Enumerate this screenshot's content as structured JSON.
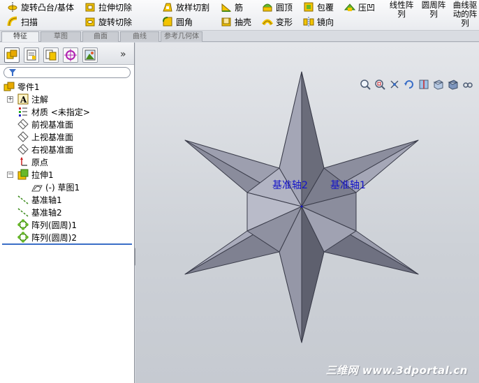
{
  "toolbar": {
    "revolve_boss": "旋转凸台/基体",
    "extruded_cut": "拉伸切除",
    "lofted_cut": "放样切割",
    "rib": "筋",
    "dome": "圆顶",
    "wrap": "包覆",
    "indent": "压凹",
    "sweep": "扫描",
    "revolved_cut": "旋转切除",
    "fillet": "圆角",
    "shell": "抽壳",
    "flex": "变形",
    "mirror": "镜向",
    "linear_pattern": "线性阵\n列",
    "circular_pattern": "圆周阵\n列",
    "curve_pattern": "曲线驱\n动的阵\n列"
  },
  "tabs": [
    "特征",
    "草图",
    "曲面",
    "曲线",
    "参考几何体"
  ],
  "tree": {
    "root": "零件1",
    "items": [
      {
        "label": "注解",
        "icon": "annotations-icon"
      },
      {
        "label": "材质 <未指定>",
        "icon": "material-icon"
      },
      {
        "label": "前视基准面",
        "icon": "plane-icon"
      },
      {
        "label": "上视基准面",
        "icon": "plane-icon"
      },
      {
        "label": "右视基准面",
        "icon": "plane-icon"
      },
      {
        "label": "原点",
        "icon": "origin-icon"
      },
      {
        "label": "拉伸1",
        "icon": "extrude-icon"
      },
      {
        "label": "(-) 草图1",
        "icon": "sketch-icon"
      },
      {
        "label": "基准轴1",
        "icon": "axis-icon"
      },
      {
        "label": "基准轴2",
        "icon": "axis-icon"
      },
      {
        "label": "阵列(圆周)1",
        "icon": "circular-pattern-icon"
      },
      {
        "label": "阵列(圆周)2",
        "icon": "circular-pattern-icon"
      }
    ]
  },
  "graphics": {
    "axis1_label": "基准轴1",
    "axis2_label": "基准轴2",
    "watermark": "三维网 www.3dportal.cn"
  },
  "colors": {
    "accent": "#3a6ec7",
    "axis_label": "#1414c8",
    "star_dark": "#6a6c7a",
    "star_light": "#a4a6b6"
  }
}
